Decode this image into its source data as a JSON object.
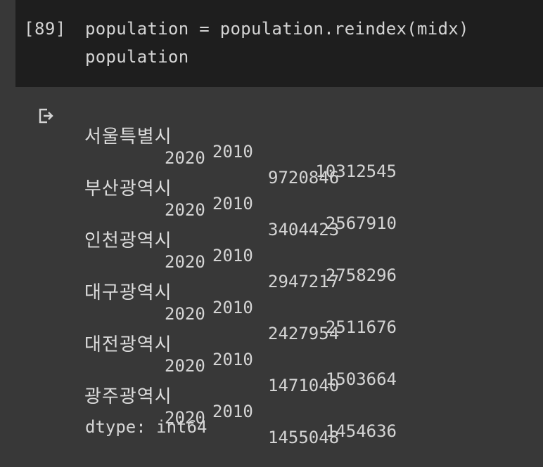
{
  "cell": {
    "execution_count": "[89]",
    "code_lines": [
      "population = population.reindex(midx)",
      "population"
    ]
  },
  "output": {
    "icon": "output-redirect-icon",
    "rows": [
      {
        "city": "서울특별시",
        "year1": "2010",
        "value1": "10312545",
        "year2": "2020",
        "value2": "9720846"
      },
      {
        "city": "부산광역시",
        "year1": "2010",
        "value1": "2567910",
        "year2": "2020",
        "value2": "3404423"
      },
      {
        "city": "인천광역시",
        "year1": "2010",
        "value1": "2758296",
        "year2": "2020",
        "value2": "2947217"
      },
      {
        "city": "대구광역시",
        "year1": "2010",
        "value1": "2511676",
        "year2": "2020",
        "value2": "2427954"
      },
      {
        "city": "대전광역시",
        "year1": "2010",
        "value1": "1503664",
        "year2": "2020",
        "value2": "1471040"
      },
      {
        "city": "광주광역시",
        "year1": "2010",
        "value1": "1454636",
        "year2": "2020",
        "value2": "1455048"
      }
    ],
    "dtype": "dtype: int64"
  }
}
